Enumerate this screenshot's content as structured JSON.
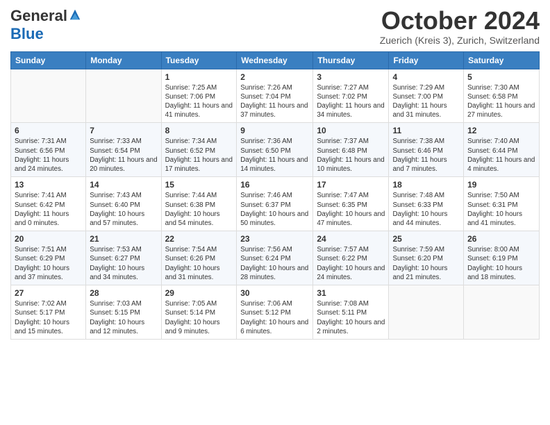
{
  "header": {
    "logo_general": "General",
    "logo_blue": "Blue",
    "title": "October 2024",
    "location": "Zuerich (Kreis 3), Zurich, Switzerland"
  },
  "days_of_week": [
    "Sunday",
    "Monday",
    "Tuesday",
    "Wednesday",
    "Thursday",
    "Friday",
    "Saturday"
  ],
  "weeks": [
    [
      {
        "day": "",
        "detail": ""
      },
      {
        "day": "",
        "detail": ""
      },
      {
        "day": "1",
        "detail": "Sunrise: 7:25 AM\nSunset: 7:06 PM\nDaylight: 11 hours and 41 minutes."
      },
      {
        "day": "2",
        "detail": "Sunrise: 7:26 AM\nSunset: 7:04 PM\nDaylight: 11 hours and 37 minutes."
      },
      {
        "day": "3",
        "detail": "Sunrise: 7:27 AM\nSunset: 7:02 PM\nDaylight: 11 hours and 34 minutes."
      },
      {
        "day": "4",
        "detail": "Sunrise: 7:29 AM\nSunset: 7:00 PM\nDaylight: 11 hours and 31 minutes."
      },
      {
        "day": "5",
        "detail": "Sunrise: 7:30 AM\nSunset: 6:58 PM\nDaylight: 11 hours and 27 minutes."
      }
    ],
    [
      {
        "day": "6",
        "detail": "Sunrise: 7:31 AM\nSunset: 6:56 PM\nDaylight: 11 hours and 24 minutes."
      },
      {
        "day": "7",
        "detail": "Sunrise: 7:33 AM\nSunset: 6:54 PM\nDaylight: 11 hours and 20 minutes."
      },
      {
        "day": "8",
        "detail": "Sunrise: 7:34 AM\nSunset: 6:52 PM\nDaylight: 11 hours and 17 minutes."
      },
      {
        "day": "9",
        "detail": "Sunrise: 7:36 AM\nSunset: 6:50 PM\nDaylight: 11 hours and 14 minutes."
      },
      {
        "day": "10",
        "detail": "Sunrise: 7:37 AM\nSunset: 6:48 PM\nDaylight: 11 hours and 10 minutes."
      },
      {
        "day": "11",
        "detail": "Sunrise: 7:38 AM\nSunset: 6:46 PM\nDaylight: 11 hours and 7 minutes."
      },
      {
        "day": "12",
        "detail": "Sunrise: 7:40 AM\nSunset: 6:44 PM\nDaylight: 11 hours and 4 minutes."
      }
    ],
    [
      {
        "day": "13",
        "detail": "Sunrise: 7:41 AM\nSunset: 6:42 PM\nDaylight: 11 hours and 0 minutes."
      },
      {
        "day": "14",
        "detail": "Sunrise: 7:43 AM\nSunset: 6:40 PM\nDaylight: 10 hours and 57 minutes."
      },
      {
        "day": "15",
        "detail": "Sunrise: 7:44 AM\nSunset: 6:38 PM\nDaylight: 10 hours and 54 minutes."
      },
      {
        "day": "16",
        "detail": "Sunrise: 7:46 AM\nSunset: 6:37 PM\nDaylight: 10 hours and 50 minutes."
      },
      {
        "day": "17",
        "detail": "Sunrise: 7:47 AM\nSunset: 6:35 PM\nDaylight: 10 hours and 47 minutes."
      },
      {
        "day": "18",
        "detail": "Sunrise: 7:48 AM\nSunset: 6:33 PM\nDaylight: 10 hours and 44 minutes."
      },
      {
        "day": "19",
        "detail": "Sunrise: 7:50 AM\nSunset: 6:31 PM\nDaylight: 10 hours and 41 minutes."
      }
    ],
    [
      {
        "day": "20",
        "detail": "Sunrise: 7:51 AM\nSunset: 6:29 PM\nDaylight: 10 hours and 37 minutes."
      },
      {
        "day": "21",
        "detail": "Sunrise: 7:53 AM\nSunset: 6:27 PM\nDaylight: 10 hours and 34 minutes."
      },
      {
        "day": "22",
        "detail": "Sunrise: 7:54 AM\nSunset: 6:26 PM\nDaylight: 10 hours and 31 minutes."
      },
      {
        "day": "23",
        "detail": "Sunrise: 7:56 AM\nSunset: 6:24 PM\nDaylight: 10 hours and 28 minutes."
      },
      {
        "day": "24",
        "detail": "Sunrise: 7:57 AM\nSunset: 6:22 PM\nDaylight: 10 hours and 24 minutes."
      },
      {
        "day": "25",
        "detail": "Sunrise: 7:59 AM\nSunset: 6:20 PM\nDaylight: 10 hours and 21 minutes."
      },
      {
        "day": "26",
        "detail": "Sunrise: 8:00 AM\nSunset: 6:19 PM\nDaylight: 10 hours and 18 minutes."
      }
    ],
    [
      {
        "day": "27",
        "detail": "Sunrise: 7:02 AM\nSunset: 5:17 PM\nDaylight: 10 hours and 15 minutes."
      },
      {
        "day": "28",
        "detail": "Sunrise: 7:03 AM\nSunset: 5:15 PM\nDaylight: 10 hours and 12 minutes."
      },
      {
        "day": "29",
        "detail": "Sunrise: 7:05 AM\nSunset: 5:14 PM\nDaylight: 10 hours and 9 minutes."
      },
      {
        "day": "30",
        "detail": "Sunrise: 7:06 AM\nSunset: 5:12 PM\nDaylight: 10 hours and 6 minutes."
      },
      {
        "day": "31",
        "detail": "Sunrise: 7:08 AM\nSunset: 5:11 PM\nDaylight: 10 hours and 2 minutes."
      },
      {
        "day": "",
        "detail": ""
      },
      {
        "day": "",
        "detail": ""
      }
    ]
  ]
}
